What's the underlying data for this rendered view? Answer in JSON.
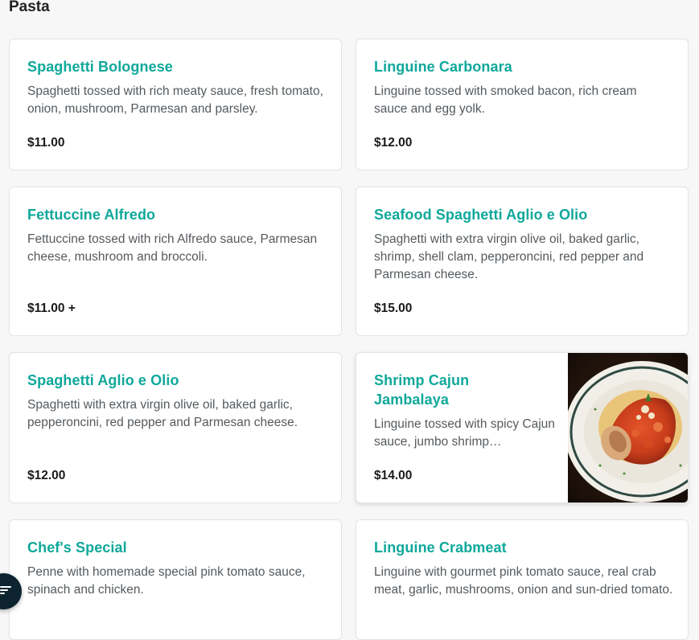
{
  "section": {
    "title": "Pasta"
  },
  "menu_items": [
    {
      "name": "Spaghetti Bolognese",
      "description": "Spaghetti tossed with rich meaty sauce, fresh tomato, onion, mushroom, Parmesan and parsley.",
      "price": "$11.00"
    },
    {
      "name": "Linguine Carbonara",
      "description": "Linguine tossed with smoked bacon, rich cream sauce and egg yolk.",
      "price": "$12.00"
    },
    {
      "name": "Fettuccine Alfredo",
      "description": "Fettuccine tossed with rich Alfredo sauce, Parmesan cheese, mushroom and broccoli.",
      "price": "$11.00 +"
    },
    {
      "name": "Seafood Spaghetti Aglio e Olio",
      "description": "Spaghetti with extra virgin olive oil, baked garlic, shrimp, shell clam, pepperoncini, red pepper and Parmesan cheese.",
      "price": "$15.00"
    },
    {
      "name": "Spaghetti Aglio e Olio",
      "description": "Spaghetti with extra virgin olive oil, baked garlic, pepperoncini, red pepper and Parmesan cheese.",
      "price": "$12.00"
    },
    {
      "name": "Shrimp Cajun Jambalaya",
      "description": "Linguine tossed with spicy Cajun sauce, jumbo shrimp…",
      "price": "$14.00"
    },
    {
      "name": "Chef's Special",
      "description": "Penne with homemade special pink tomato sauce, spinach and chicken."
    },
    {
      "name": "Linguine Crabmeat",
      "description": "Linguine with gourmet pink tomato sauce, real crab meat, garlic, mushrooms, onion and sun-dried tomato."
    }
  ],
  "filter_button": {
    "icon": "filter-icon"
  },
  "colors": {
    "item_title": "#0fa89b",
    "fab_background": "#0d2430",
    "page_background": "#f7f7f7"
  }
}
